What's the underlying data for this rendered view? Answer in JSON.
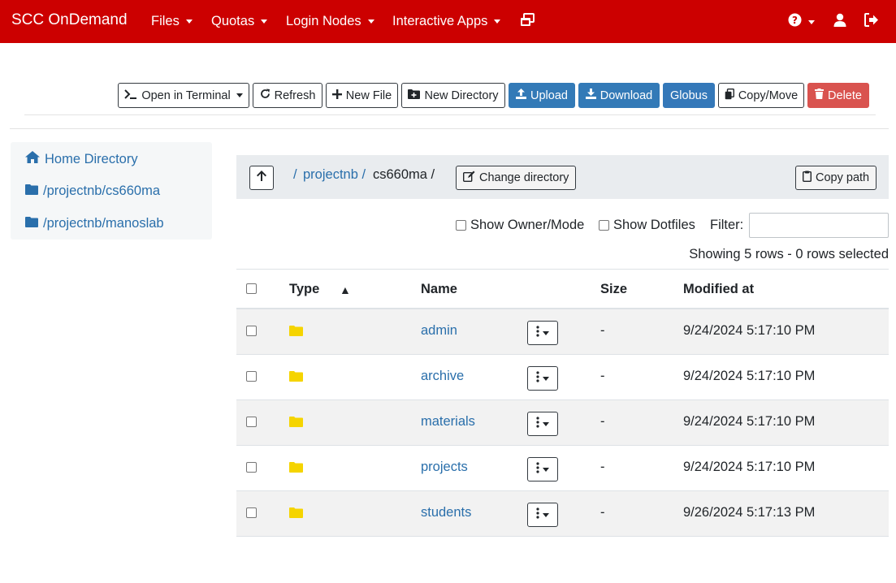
{
  "navbar": {
    "brand": "SCC OnDemand",
    "menus": [
      "Files",
      "Quotas",
      "Login Nodes",
      "Interactive Apps"
    ],
    "icons": [
      "windows-icon",
      "help-icon",
      "user-icon",
      "logout-icon"
    ],
    "color": "#cc0000"
  },
  "toolbar": {
    "open_terminal": "Open in Terminal",
    "refresh": "Refresh",
    "new_file": "New File",
    "new_directory": "New Directory",
    "upload": "Upload",
    "download": "Download",
    "globus": "Globus",
    "copy_move": "Copy/Move",
    "delete": "Delete"
  },
  "sidebar": {
    "items": [
      {
        "label": "Home Directory",
        "icon": "home-icon"
      },
      {
        "label": "/projectnb/cs660ma",
        "icon": "folder-icon"
      },
      {
        "label": "/projectnb/manoslab",
        "icon": "folder-icon"
      }
    ]
  },
  "breadcrumb": {
    "root": "/",
    "seg1": "projectnb /",
    "seg2": "cs660ma /",
    "change_directory": "Change directory",
    "copy_path": "Copy path"
  },
  "filters": {
    "show_owner_mode": "Show Owner/Mode",
    "show_dotfiles": "Show Dotfiles",
    "filter_label": "Filter:",
    "filter_value": "",
    "showing": "Showing 5 rows - 0 rows selected"
  },
  "table": {
    "headers": {
      "type": "Type",
      "name": "Name",
      "size": "Size",
      "modified": "Modified at"
    },
    "sort_indicator": "▲",
    "rows": [
      {
        "name": "admin",
        "size": "-",
        "modified": "9/24/2024 5:17:10 PM"
      },
      {
        "name": "archive",
        "size": "-",
        "modified": "9/24/2024 5:17:10 PM"
      },
      {
        "name": "materials",
        "size": "-",
        "modified": "9/24/2024 5:17:10 PM"
      },
      {
        "name": "projects",
        "size": "-",
        "modified": "9/24/2024 5:17:10 PM"
      },
      {
        "name": "students",
        "size": "-",
        "modified": "9/26/2024 5:17:13 PM"
      }
    ]
  }
}
